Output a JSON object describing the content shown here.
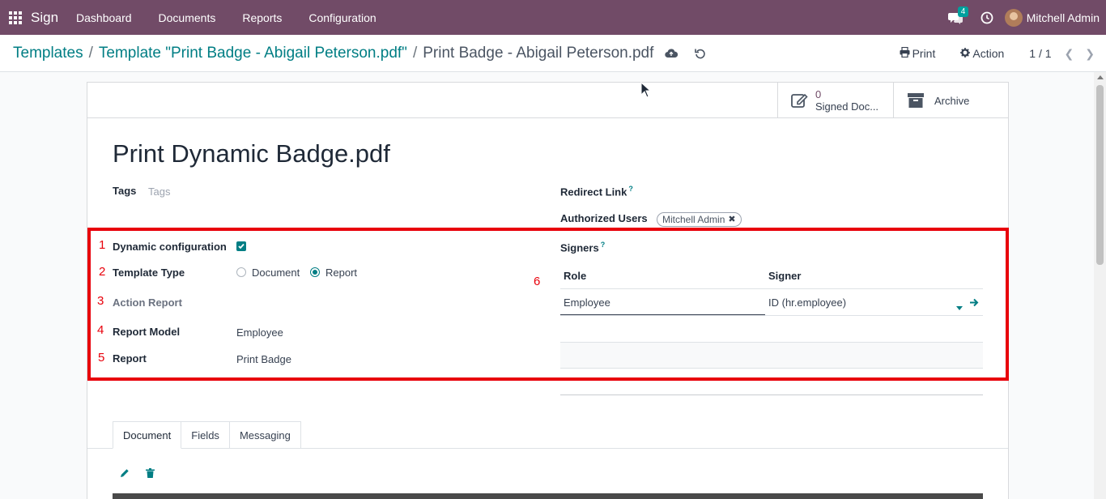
{
  "navbar": {
    "brand": "Sign",
    "menu": [
      "Dashboard",
      "Documents",
      "Reports",
      "Configuration"
    ],
    "chat_count": "4",
    "user_name": "Mitchell Admin"
  },
  "breadcrumb": {
    "items": [
      "Templates",
      "Template \"Print Badge - Abigail Peterson.pdf\""
    ],
    "separator": "/",
    "current": "Print Badge - Abigail Peterson.pdf"
  },
  "control": {
    "print_label": "Print",
    "action_label": "Action",
    "pager": "1 / 1"
  },
  "stats": {
    "signed_value": "0",
    "signed_label": "Signed Doc...",
    "archive_label": "Archive"
  },
  "form": {
    "title": "Print Dynamic Badge.pdf",
    "tags_label": "Tags",
    "tags_placeholder": "Tags",
    "redirect_label": "Redirect Link",
    "authorized_label": "Authorized Users",
    "authorized_user": "Mitchell Admin",
    "help_mark": "?",
    "dynamic_label": "Dynamic configuration",
    "dynamic_checked": true,
    "template_type_label": "Template Type",
    "template_type_options": [
      "Document",
      "Report"
    ],
    "template_type_selected": "Report",
    "action_report_label": "Action Report",
    "report_model_label": "Report Model",
    "report_model_value": "Employee",
    "report_label": "Report",
    "report_value": "Print Badge",
    "signers_label": "Signers"
  },
  "annotations": [
    "1",
    "2",
    "3",
    "4",
    "5",
    "6"
  ],
  "signers_table": {
    "columns": [
      "Role",
      "Signer"
    ],
    "rows": [
      {
        "role": "Employee",
        "signer": "ID (hr.employee)"
      }
    ]
  },
  "tabs": [
    "Document",
    "Fields",
    "Messaging"
  ],
  "active_tab": "Document",
  "colors": {
    "navbar": "#714b67",
    "link": "#017e84",
    "highlight": "#e8000b"
  }
}
